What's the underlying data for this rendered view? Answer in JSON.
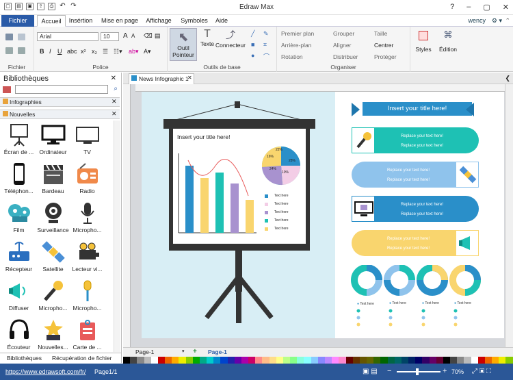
{
  "app": {
    "title": "Edraw Max",
    "user": "wency"
  },
  "menu": {
    "file": "Fichier",
    "tabs": [
      "Accueil",
      "Insértion",
      "Mise en page",
      "Affichage",
      "Symboles",
      "Aide"
    ]
  },
  "ribbon": {
    "groups": {
      "file": "Fichier",
      "font": "Police",
      "tools": "Outils de base",
      "arrange": "Organiser"
    },
    "font_name": "Arial",
    "font_size": "10",
    "tool_pointer": "Outil Pointeur",
    "tool_text": "Texte",
    "tool_connector": "Connecteur",
    "arrange": [
      "Premier plan",
      "Arrière-plan",
      "Rotation",
      "Grouper",
      "Aligner",
      "Distribuer",
      "Taille",
      "Centrer",
      "Protéger"
    ],
    "styles": "Styles",
    "edition": "Édition"
  },
  "library": {
    "title": "Bibliothèques",
    "sections": [
      "Infographies",
      "Nouvelles"
    ],
    "items": [
      "Écran de ...",
      "Ordinateur",
      "TV",
      "Téléphon...",
      "Bardeau",
      "Radio",
      "Film",
      "Surveillance",
      "Micropho...",
      "Récepteur",
      "Satellite",
      "Lecteur vi...",
      "Diffuser",
      "Micropho...",
      "Micropho...",
      "Écouteur",
      "Nouvelles...",
      "Carte de ..."
    ],
    "bottom_tabs": [
      "Bibliothèques",
      "Récupération de fichier"
    ]
  },
  "document": {
    "tab": "News Infographic 1",
    "board_title": "Insert your title here!",
    "main_title": "Insert your title here!",
    "pie_labels": [
      "22%",
      "28%",
      "10%",
      "24%",
      "16%"
    ],
    "legend": [
      "Text here",
      "Text here",
      "Text here",
      "Text here",
      "Text here"
    ],
    "pill_text": [
      "Replace your text here!",
      "Replace your text here!"
    ],
    "donut_text": [
      "Text here",
      "Text here",
      "Text here",
      "Text here"
    ]
  },
  "pages": {
    "current": "Page-1",
    "tab": "Page-1"
  },
  "status": {
    "url": "https://www.edrawsoft.com/fr/",
    "page": "Page1/1",
    "zoom": "70%"
  },
  "colors": {
    "accent": "#2b5797",
    "teal": "#1ec1b4",
    "blue": "#2a8fc9",
    "yellow": "#f9d56e",
    "lightblue": "#8fc3ec",
    "purple": "#a892cf"
  }
}
